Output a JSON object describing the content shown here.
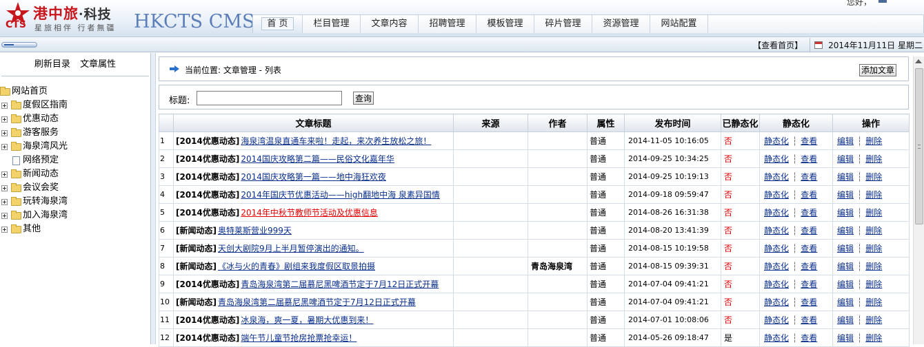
{
  "header": {
    "brand_cn": "港中旅",
    "brand_sub": "·科技",
    "logo_cts": "CTS",
    "slogan": "星旅相伴 行者無疆",
    "cms_title": "HKCTS CMS",
    "user_text": "您好，",
    "nav": [
      {
        "label": "首 页",
        "active": true
      },
      {
        "label": "栏目管理"
      },
      {
        "label": "文章内容"
      },
      {
        "label": "招聘管理"
      },
      {
        "label": "模板管理"
      },
      {
        "label": "碎片管理"
      },
      {
        "label": "资源管理"
      },
      {
        "label": "网站配置"
      }
    ]
  },
  "toolbar": {
    "view_home": "【查看首页】",
    "date": "2014年11月11日 星期二"
  },
  "sidebar": {
    "refresh": "刷新目录",
    "article_attr": "文章属性",
    "root": "网站首页",
    "items": [
      {
        "label": "度假区指南",
        "type": "folder"
      },
      {
        "label": "优惠动态",
        "type": "folder"
      },
      {
        "label": "游客服务",
        "type": "folder"
      },
      {
        "label": "海泉湾风光",
        "type": "folder"
      },
      {
        "label": "网络预定",
        "type": "doc"
      },
      {
        "label": "新闻动态",
        "type": "folder"
      },
      {
        "label": "会议会奖",
        "type": "folder"
      },
      {
        "label": "玩转海泉湾",
        "type": "folder"
      },
      {
        "label": "加入海泉湾",
        "type": "folder"
      },
      {
        "label": "其他",
        "type": "folder"
      }
    ]
  },
  "location": {
    "text": "当前位置: 文章管理 - 列表",
    "add_button": "添加文章"
  },
  "search": {
    "label": "标题:",
    "value": "",
    "button": "查询"
  },
  "table": {
    "headers": [
      "文章标题",
      "来源",
      "作者",
      "属性",
      "发布时间",
      "已静态化",
      "静态化",
      "操作"
    ],
    "action_static": "静态化",
    "action_view": "查看",
    "action_edit": "编辑",
    "action_delete": "删除",
    "rows": [
      {
        "n": "1",
        "cat": "[2014优惠动态]",
        "title": "海泉湾温泉直通车来啦！走起，来次养生放松之旅！",
        "source": "",
        "author": "",
        "attr": "普通",
        "time": "2014-11-05 10:16:05",
        "static": "否"
      },
      {
        "n": "2",
        "cat": "[2014优惠动态]",
        "title": "2014国庆攻略第二篇——民俗文化嘉年华",
        "source": "",
        "author": "",
        "attr": "普通",
        "time": "2014-09-25 10:34:25",
        "static": "否"
      },
      {
        "n": "3",
        "cat": "[2014优惠动态]",
        "title": "2014国庆攻略第一篇——地中海狂欢夜",
        "source": "",
        "author": "",
        "attr": "普通",
        "time": "2014-09-25 10:19:13",
        "static": "否"
      },
      {
        "n": "4",
        "cat": "[2014优惠动态]",
        "title": "2014年国庆节优惠活动——high翻地中海 泉素异国情",
        "source": "",
        "author": "",
        "attr": "普通",
        "time": "2014-09-18 09:59:47",
        "static": "否"
      },
      {
        "n": "5",
        "cat": "[2014优惠动态]",
        "title": "2014年中秋节教师节活动及优惠信息",
        "source": "",
        "author": "",
        "attr": "普通",
        "time": "2014-08-26 16:31:38",
        "static": "否",
        "red": true
      },
      {
        "n": "6",
        "cat": "[新闻动态]",
        "title": "奥特莱斯营业999天",
        "source": "",
        "author": "",
        "attr": "普通",
        "time": "2014-08-20 13:41:39",
        "static": "否"
      },
      {
        "n": "7",
        "cat": "[新闻动态]",
        "title": "天创大剧院9月上半月暂停演出的通知。",
        "source": "",
        "author": "",
        "attr": "普通",
        "time": "2014-08-15 10:19:58",
        "static": "否"
      },
      {
        "n": "8",
        "cat": "[新闻动态]",
        "title": "《冰与火的青春》剧组来我度假区取景拍摄",
        "source": "",
        "author": "青岛海泉湾",
        "attr": "普通",
        "time": "2014-08-15 09:39:31",
        "static": "否"
      },
      {
        "n": "9",
        "cat": "[2014优惠动态]",
        "title": "青岛海泉湾第二届慕尼黑啤酒节定于7月12日正式开幕",
        "source": "",
        "author": "",
        "attr": "普通",
        "time": "2014-07-04 09:41:21",
        "static": "否"
      },
      {
        "n": "10",
        "cat": "[新闻动态]",
        "title": "青岛海泉湾第二届慕尼黑啤酒节定于7月12日正式开幕",
        "source": "",
        "author": "",
        "attr": "普通",
        "time": "2014-07-04 09:41:21",
        "static": "否"
      },
      {
        "n": "11",
        "cat": "[2014优惠动态]",
        "title": "冰泉海，爽一夏，暑期大优惠到来！",
        "source": "",
        "author": "",
        "attr": "普通",
        "time": "2014-07-01 10:08:06",
        "static": "否"
      },
      {
        "n": "12",
        "cat": "[2014优惠动态]",
        "title": "端午节儿童节抢房抢票抢幸运！",
        "source": "",
        "author": "",
        "attr": "普通",
        "time": "2014-05-26 09:18:47",
        "static": "是"
      }
    ]
  }
}
